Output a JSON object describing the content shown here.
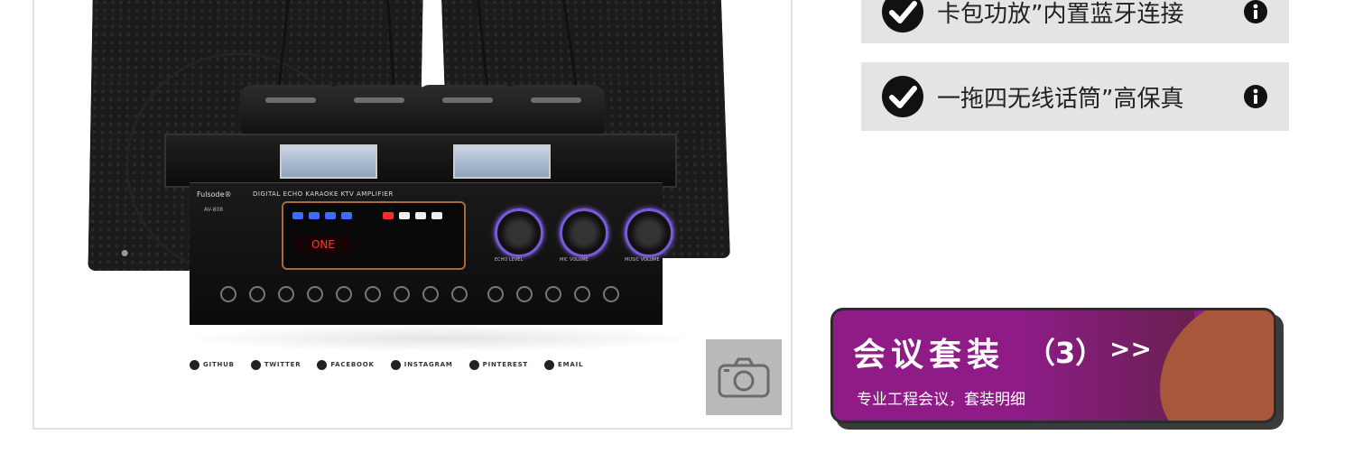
{
  "product_image": {
    "amp_brand": "Fulsode®",
    "amp_model": "AV-808",
    "amp_title": "DIGITAL ECHO KARAOKE KTV AMPLIFIER",
    "amp_display": "ONE",
    "dial_labels": [
      "ECHO LEVEL",
      "MIC VOLUME",
      "MUSIC VOLUME"
    ],
    "social_links": [
      {
        "label": "GITHUB",
        "icon": "github-icon"
      },
      {
        "label": "TWITTER",
        "icon": "twitter-icon"
      },
      {
        "label": "FACEBOOK",
        "icon": "facebook-icon"
      },
      {
        "label": "INSTAGRAM",
        "icon": "instagram-icon"
      },
      {
        "label": "PINTEREST",
        "icon": "pinterest-icon"
      },
      {
        "label": "EMAIL",
        "icon": "email-icon"
      }
    ],
    "camera_icon": "camera-icon"
  },
  "features": [
    {
      "text": "卡包功放”内置蓝牙连接",
      "icon": "check-circle-icon",
      "info_icon": "info-icon"
    },
    {
      "text": "一拖四无线话筒”高保真",
      "icon": "check-circle-icon",
      "info_icon": "info-icon"
    }
  ],
  "promo": {
    "title": "会议套装",
    "count": "（3）",
    "arrow": ">>",
    "subtitle": "专业工程会议，套装明细",
    "colors": {
      "primary": "#8f1b87",
      "accent": "#a8573b"
    }
  }
}
